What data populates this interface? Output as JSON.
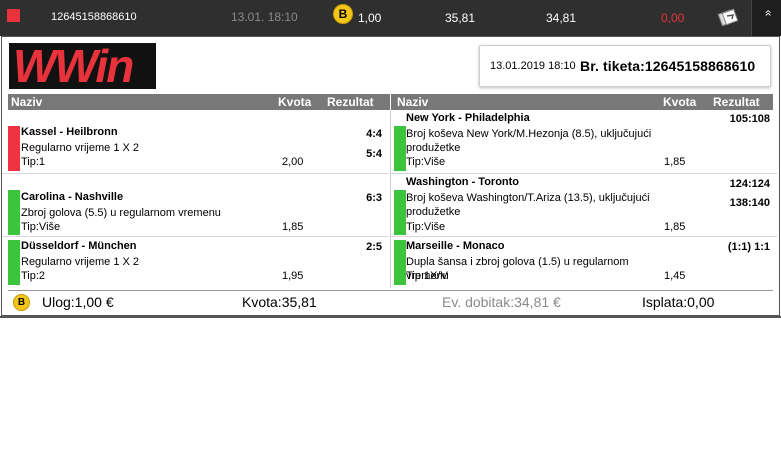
{
  "topbar": {
    "ticket_id": "12645158868610",
    "datetime": "13.01. 18:10",
    "bonus_icon": "B",
    "stake": "1,00",
    "odds": "35,81",
    "potential_win": "34,81",
    "payout": "0,00",
    "refresh_icon": "refresh-icon",
    "expand_icon": "double-chevron-up-icon",
    "expand_glyph": "»"
  },
  "logo": {
    "text": "WWin"
  },
  "ticket_info": {
    "datetime": "13.01.2019 18:10",
    "label": "Br. tiketa:12645158868610"
  },
  "headers": {
    "left": {
      "name": "Naziv",
      "odds": "Kvota",
      "result": "Rezultat"
    },
    "right": {
      "name": "Naziv",
      "odds": "Kvota",
      "result": "Rezultat"
    }
  },
  "left_rows": [
    {
      "match": "Kassel - Heilbronn",
      "market": "Regularno vrijeme 1 X 2",
      "tip": "Tip:1",
      "odds": "2,00",
      "results": [
        "4:4",
        "5:4"
      ],
      "status": "lost",
      "status_color": "#ef3340"
    },
    {
      "match": "Carolina - Nashville",
      "market": "Zbroj golova (5.5) u regularnom vremenu",
      "tip": "Tip:Više",
      "odds": "1,85",
      "results": [
        "6:3"
      ],
      "status": "won",
      "status_color": "#3dc43d"
    },
    {
      "match": "Düsseldorf - München",
      "market": "Regularno vrijeme 1 X 2",
      "tip": "Tip:2",
      "odds": "1,95",
      "results": [
        "2:5"
      ],
      "status": "won",
      "status_color": "#3dc43d"
    }
  ],
  "right_rows": [
    {
      "match": "New York - Philadelphia",
      "market_line1": "Broj koševa New York/M.Hezonja (8.5), uključujući",
      "market_line2": "produžetke",
      "tip": "Tip:Više",
      "odds": "1,85",
      "results": [
        "105:108"
      ],
      "status": "won",
      "status_color": "#3dc43d"
    },
    {
      "match": "Washington - Toronto",
      "market_line1": "Broj koševa Washington/T.Ariza (13.5), uključujući",
      "market_line2": "produžetke",
      "tip": "Tip:Više",
      "odds": "1,85",
      "results": [
        "124:124",
        "138:140"
      ],
      "status": "won",
      "status_color": "#3dc43d"
    },
    {
      "match": "Marseille - Monaco",
      "market_line1": "Dupla šansa i zbroj golova (1.5) u regularnom",
      "market_line2": "vremenu",
      "tip": "Tip:1X/V",
      "odds": "1,45",
      "results": [
        "(1:1) 1:1"
      ],
      "status": "won",
      "status_color": "#3dc43d"
    }
  ],
  "footer": {
    "bonus_icon": "B",
    "stake": "Ulog:1,00 €",
    "odds": "Kvota:35,81",
    "potential_win": "Ev. dobitak:34,81 €",
    "payout": "Isplata:0,00"
  }
}
